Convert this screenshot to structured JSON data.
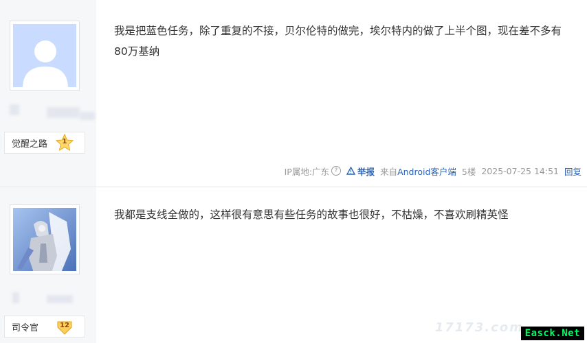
{
  "posts": [
    {
      "level": {
        "name": "觉醒之路",
        "number": "1"
      },
      "content": "我是把蓝色任务，除了重复的不接，贝尔伦特的做完，埃尔特内的做了上半个图，现在差不多有80万基纳",
      "meta": {
        "ip_label": "IP属地:广东",
        "help_glyph": "?",
        "report": "举报",
        "from_prefix": "来自",
        "from_client": "Android客户端",
        "floor": "5楼",
        "time": "2025-07-25 14:51",
        "reply": "回复"
      }
    },
    {
      "level": {
        "name": "司令官",
        "number": "12"
      },
      "content": "我都是支线全做的，这样很有意思有些任务的故事也很好，不枯燥，不喜欢刷精英怪"
    }
  ],
  "watermark": "Easck.Net",
  "watermark_faint": "17173.com",
  "colors": {
    "link": "#2d64b3",
    "meta": "#999999",
    "sidebar": "#f6f7f9",
    "watermark_text": "#00ff66"
  }
}
